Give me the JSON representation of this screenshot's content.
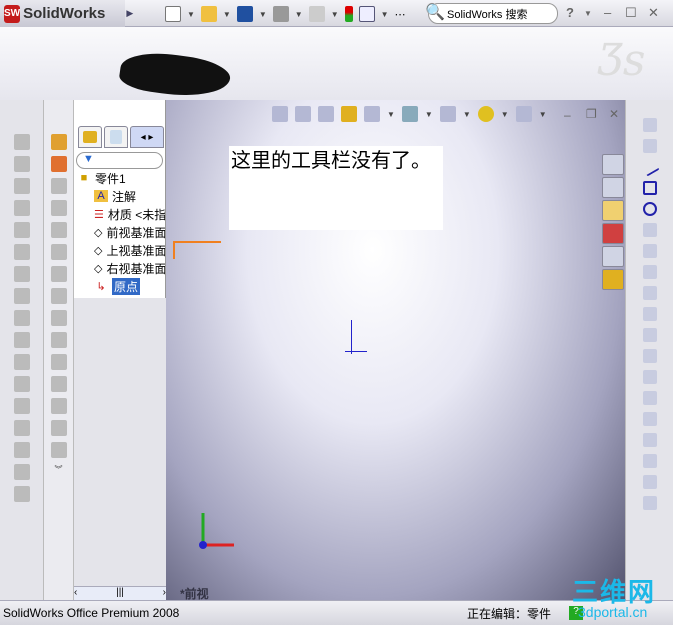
{
  "app": {
    "name": "SolidWorks",
    "search_placeholder": "SolidWorks 搜索",
    "help": "?"
  },
  "tree": {
    "root": "零件1",
    "nodes": [
      {
        "label": "注解",
        "icon": "annotation-icon"
      },
      {
        "label": "材质 <未指定>",
        "icon": "material-icon"
      },
      {
        "label": "前视基准面",
        "icon": "plane-icon"
      },
      {
        "label": "上视基准面",
        "icon": "plane-icon"
      },
      {
        "label": "右视基准面",
        "icon": "plane-icon"
      },
      {
        "label": "原点",
        "icon": "origin-icon",
        "selected": true
      }
    ]
  },
  "note": "这里的工具栏没有了。",
  "view": {
    "name": "*前视"
  },
  "status": {
    "product": "SolidWorks Office Premium 2008",
    "mode": "正在编辑：零件"
  },
  "watermark": {
    "title": "三维网",
    "url": "3dportal.cn"
  },
  "colors": {
    "accent": "#3169c6",
    "sketch_orange": "#f08020"
  }
}
